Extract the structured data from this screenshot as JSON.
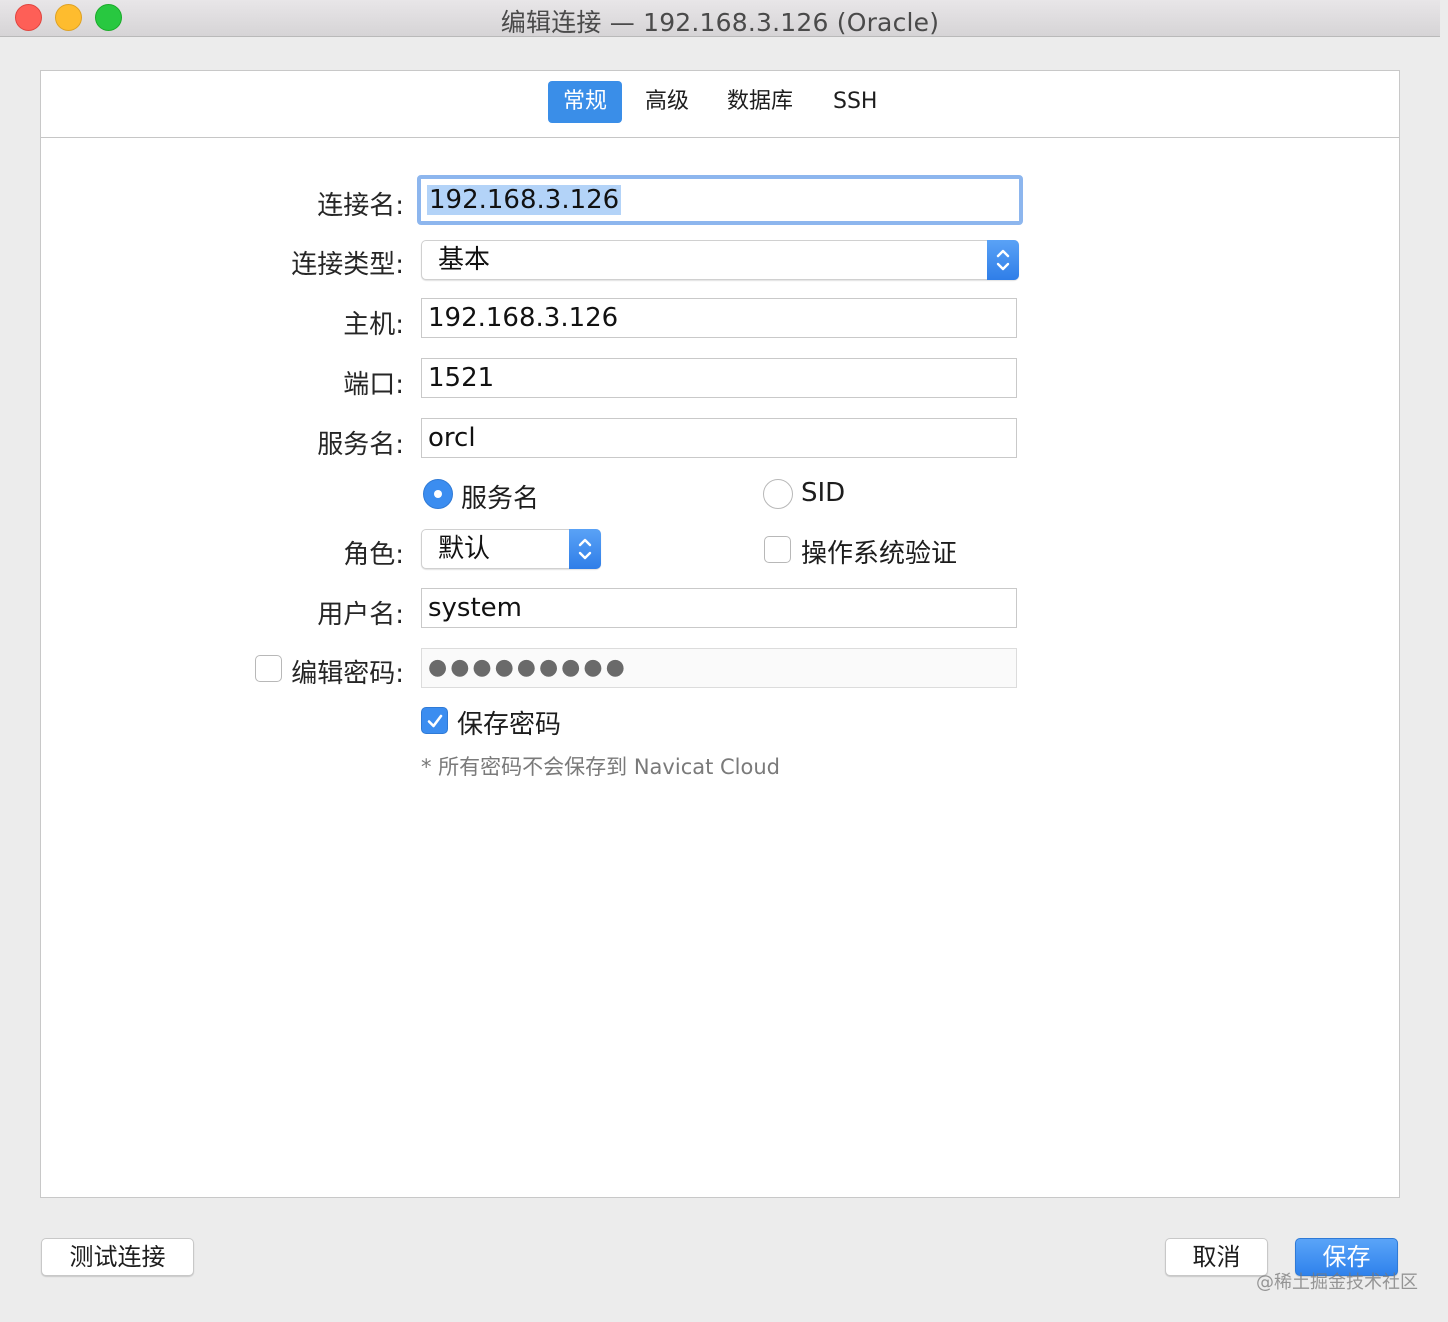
{
  "window": {
    "title": "编辑连接 — 192.168.3.126 (Oracle)"
  },
  "tabs": [
    {
      "label": "常规",
      "active": true
    },
    {
      "label": "高级",
      "active": false
    },
    {
      "label": "数据库",
      "active": false
    },
    {
      "label": "SSH",
      "active": false
    }
  ],
  "form": {
    "connection_name": {
      "label": "连接名:",
      "value": "192.168.3.126"
    },
    "connection_type": {
      "label": "连接类型:",
      "value": "基本"
    },
    "host": {
      "label": "主机:",
      "value": "192.168.3.126"
    },
    "port": {
      "label": "端口:",
      "value": "1521"
    },
    "service_name": {
      "label": "服务名:",
      "value": "orcl"
    },
    "service_mode": {
      "options": [
        {
          "label": "服务名",
          "selected": true
        },
        {
          "label": "SID",
          "selected": false
        }
      ]
    },
    "role": {
      "label": "角色:",
      "value": "默认"
    },
    "os_auth": {
      "label": "操作系统验证",
      "checked": false
    },
    "username": {
      "label": "用户名:",
      "value": "system"
    },
    "edit_password": {
      "label": "编辑密码:",
      "checked": false,
      "masked_value": "●●●●●●●●●"
    },
    "save_password": {
      "label": "保存密码",
      "checked": true
    },
    "note": "* 所有密码不会保存到 Navicat Cloud"
  },
  "footer": {
    "test_button": "测试连接",
    "cancel_button": "取消",
    "save_button": "保存"
  },
  "watermark": "@稀土掘金技术社区",
  "colors": {
    "accent": "#3a8ee8",
    "focus_ring": "#8db6ee"
  }
}
